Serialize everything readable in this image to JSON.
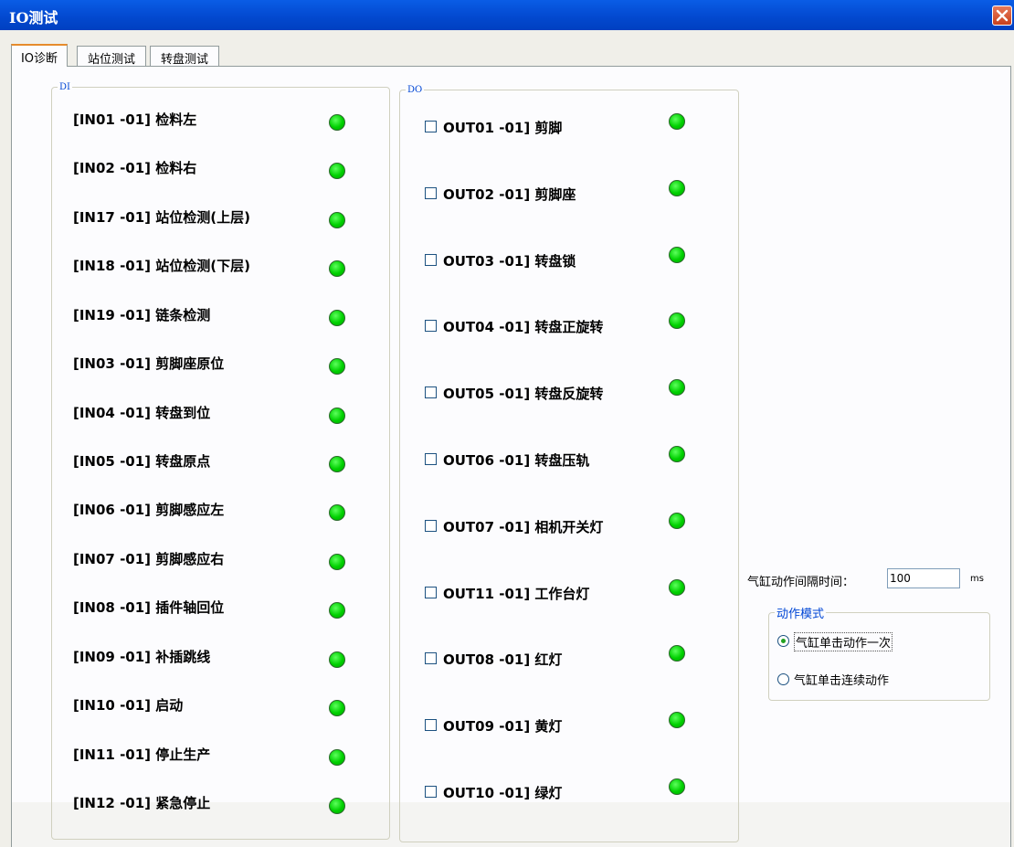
{
  "window": {
    "title": "IO测试"
  },
  "tabs": [
    {
      "label": "IO诊断",
      "active": true
    },
    {
      "label": "站位测试",
      "active": false
    },
    {
      "label": "转盘测试",
      "active": false
    }
  ],
  "di": {
    "legend": "DI",
    "items": [
      {
        "label": "[IN01 -01] 检料左",
        "state": "on"
      },
      {
        "label": "[IN02 -01] 检料右",
        "state": "on"
      },
      {
        "label": "[IN17 -01] 站位检测(上层)",
        "state": "on"
      },
      {
        "label": "[IN18 -01] 站位检测(下层)",
        "state": "on"
      },
      {
        "label": "[IN19 -01] 链条检测",
        "state": "on"
      },
      {
        "label": "[IN03 -01] 剪脚座原位",
        "state": "on"
      },
      {
        "label": "[IN04 -01] 转盘到位",
        "state": "on"
      },
      {
        "label": "[IN05 -01] 转盘原点",
        "state": "on"
      },
      {
        "label": "[IN06 -01] 剪脚感应左",
        "state": "on"
      },
      {
        "label": "[IN07 -01] 剪脚感应右",
        "state": "on"
      },
      {
        "label": "[IN08 -01] 插件轴回位",
        "state": "on"
      },
      {
        "label": "[IN09 -01] 补插跳线",
        "state": "on"
      },
      {
        "label": "[IN10 -01] 启动",
        "state": "on"
      },
      {
        "label": "[IN11 -01] 停止生产",
        "state": "on"
      },
      {
        "label": "[IN12 -01] 紧急停止",
        "state": "on"
      }
    ]
  },
  "do": {
    "legend": "DO",
    "items": [
      {
        "label": "OUT01 -01] 剪脚",
        "checked": false,
        "state": "on"
      },
      {
        "label": "OUT02 -01] 剪脚座",
        "checked": false,
        "state": "on"
      },
      {
        "label": "OUT03 -01] 转盘锁",
        "checked": false,
        "state": "on"
      },
      {
        "label": "OUT04 -01] 转盘正旋转",
        "checked": false,
        "state": "on"
      },
      {
        "label": "OUT05 -01] 转盘反旋转",
        "checked": false,
        "state": "on"
      },
      {
        "label": "OUT06 -01] 转盘压轨",
        "checked": false,
        "state": "on"
      },
      {
        "label": "OUT07 -01] 相机开关灯",
        "checked": false,
        "state": "on"
      },
      {
        "label": "OUT11 -01] 工作台灯",
        "checked": false,
        "state": "on"
      },
      {
        "label": "OUT08 -01] 红灯",
        "checked": false,
        "state": "on"
      },
      {
        "label": "OUT09 -01] 黄灯",
        "checked": false,
        "state": "on"
      },
      {
        "label": "OUT10 -01] 绿灯",
        "checked": false,
        "state": "on"
      }
    ]
  },
  "settings": {
    "interval_label": "气缸动作间隔时间：",
    "interval_value": "100",
    "interval_unit": "ms",
    "mode_legend": "动作模式",
    "modes": [
      {
        "label": "气缸单击动作一次",
        "selected": true
      },
      {
        "label": "气缸单击连续动作",
        "selected": false
      }
    ]
  },
  "colors": {
    "led_on": "#00d000",
    "title_bar": "#0a5de6",
    "legend_text": "#0046d5"
  }
}
